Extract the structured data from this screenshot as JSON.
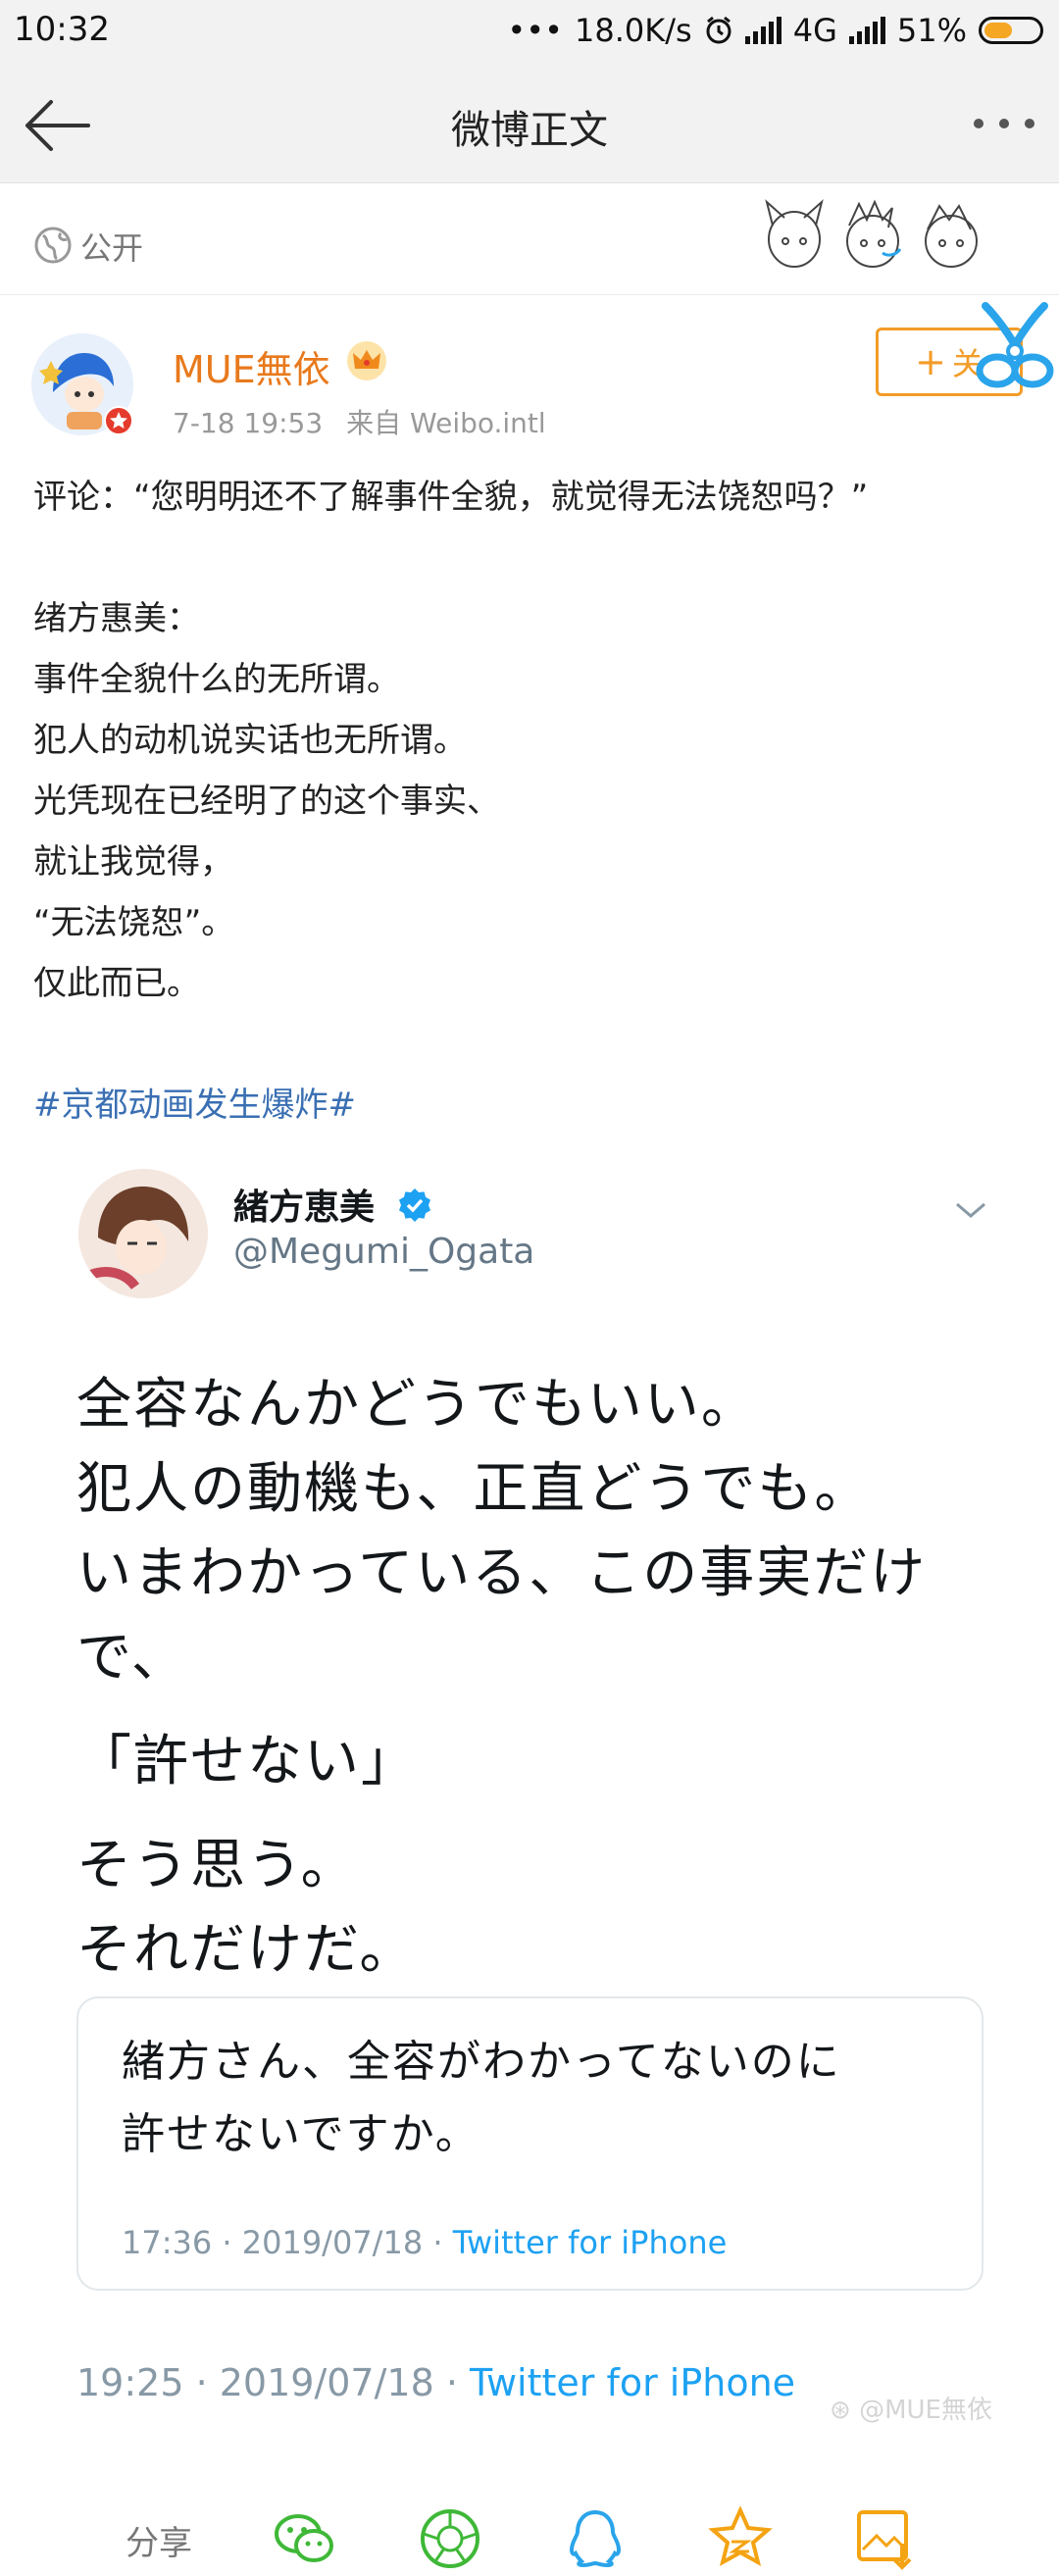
{
  "status_bar": {
    "time": "10:32",
    "dots": "•••",
    "network_speed": "18.0K/s",
    "network_type": "4G",
    "battery": "51%",
    "battery_level": 0.51
  },
  "nav": {
    "title": "微博正文"
  },
  "visibility": {
    "label": "公开"
  },
  "post": {
    "author": "MUE無依",
    "time": "7-18 19:53",
    "source": "来自 Weibo.intl",
    "follow_label": "关注",
    "follow_label_visible": "关",
    "lines": [
      "评论：“您明明还不了解事件全貌，就觉得无法饶恕吗？”",
      "",
      "绪方惠美：",
      "事件全貌什么的无所谓。",
      "犯人的动机说实话也无所谓。",
      "光凭现在已经明了的这个事实、",
      "就让我觉得，",
      "“无法饶恕”。",
      "仅此而已。",
      ""
    ],
    "hashtag": "#京都动画发生爆炸#"
  },
  "tweet": {
    "name": "緒方恵美",
    "handle": "@Megumi_Ogata",
    "text_lines": [
      "全容なんかどうでもいい。",
      "犯人の動機も、正直どうでも。",
      "いまわかっている、この事実だけ",
      "で、",
      "「許せない」",
      "そう思う。",
      "それだけだ。"
    ],
    "quote": {
      "lines": [
        "緒方さん、全容がわかってないのに",
        "許せないですか。"
      ],
      "time": "17:36 · 2019/07/18 · ",
      "client": "Twitter for iPhone"
    },
    "time": "19:25 · 2019/07/18 · ",
    "client": "Twitter for iPhone"
  },
  "watermark": "@MUE無依",
  "share": {
    "label": "分享",
    "icons": [
      "wechat-icon",
      "moments-icon",
      "qq-icon",
      "qzone-icon",
      "save-image-icon"
    ],
    "colors": {
      "green": "#3fb838",
      "blue": "#2aa4ea",
      "orange": "#f4a312",
      "qzone_yellow": "#f5c518"
    }
  },
  "colors": {
    "accent_orange": "#e8791c",
    "follow_orange": "#f39c28",
    "link_blue": "#3a6fb3",
    "twitter_blue": "#1da1f2"
  }
}
